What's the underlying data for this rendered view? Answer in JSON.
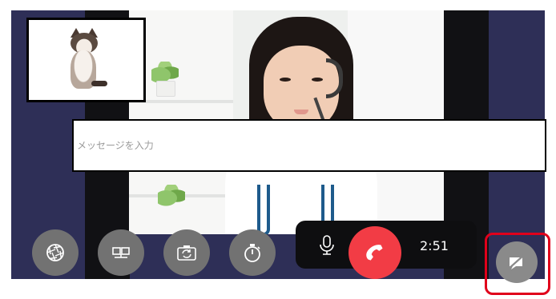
{
  "message": {
    "placeholder": "メッセージを入力"
  },
  "call": {
    "elapsed": "2:51"
  },
  "toolbar": {
    "buttons": [
      {
        "icon": "aperture-icon"
      },
      {
        "icon": "screen-switch-icon"
      },
      {
        "icon": "camera-flip-icon"
      },
      {
        "icon": "timer-icon"
      }
    ],
    "mic_icon": "microphone-icon",
    "end_call_icon": "phone-hangup-icon",
    "share_icon": "screen-share-icon"
  },
  "colors": {
    "end_call": "#f23c45",
    "highlight": "#e0001b",
    "button_gray": "#727272",
    "background": "#2e2f57"
  }
}
